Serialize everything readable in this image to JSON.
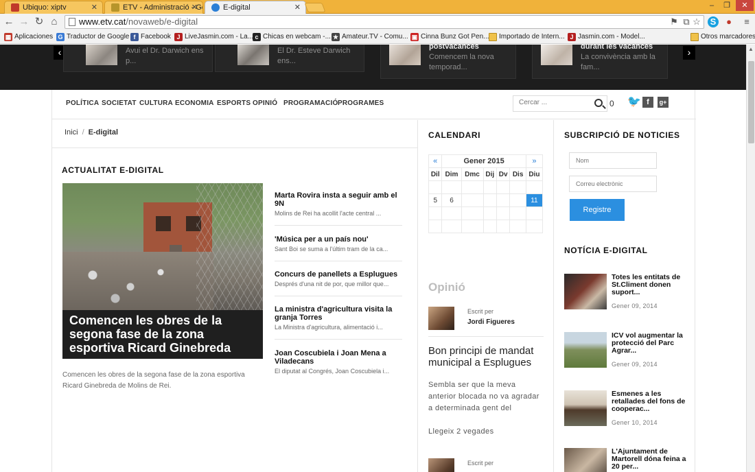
{
  "browser": {
    "tabs": [
      {
        "title": "Ubiquo: xiptv",
        "color": "#c0392b"
      },
      {
        "title": "ETV - Administració - Ges",
        "color": "#b7952b"
      },
      {
        "title": "E-digital",
        "color": "#2b7fd6"
      }
    ],
    "url_host": "www.etv.cat",
    "url_path": "/novaweb/e-digital",
    "bookmarks": [
      {
        "label": "Aplicaciones",
        "color": "#c0392b"
      },
      {
        "label": "Traductor de Google",
        "color": "#3a7bd5"
      },
      {
        "label": "Facebook",
        "color": "#3b5998"
      },
      {
        "label": "LiveJasmin.com - La...",
        "color": "#b41f1f"
      },
      {
        "label": "Chicas en webcam -...",
        "color": "#222222"
      },
      {
        "label": "Amateur.TV - Comu...",
        "color": "#444444"
      },
      {
        "label": "Cinna Bunz Got Pen...",
        "color": "#cc2222"
      },
      {
        "label": "Importado de Intern...",
        "color": "folder"
      },
      {
        "label": "Jasmin.com - Model...",
        "color": "#b41f1f"
      },
      {
        "label": "Otros marcadores",
        "color": "folder"
      }
    ]
  },
  "slider": {
    "cards": [
      {
        "title": "",
        "text": "Avui el Dr. Darwich ens p..."
      },
      {
        "title": "",
        "text": "El Dr. Esteve Darwich ens..."
      },
      {
        "title": "postvacances",
        "text": "Comencem la nova temporad..."
      },
      {
        "title": "durant les vacances",
        "text": "La convivència amb la fam..."
      }
    ],
    "prev": "‹",
    "next": "›"
  },
  "nav": {
    "items": [
      "POLÍTICA",
      "SOCIETAT",
      "CULTURA",
      "ECONOMIA",
      "ESPORTS",
      "OPINIÓ",
      "PROGRAMACIÓ",
      "PROGRAMES"
    ],
    "search_placeholder": "Cercar ...",
    "count": "0",
    "social": [
      "twitter",
      "f",
      "g+"
    ]
  },
  "breadcrumb": {
    "home": "Inici",
    "sep": "/",
    "current": "E-digital"
  },
  "main": {
    "section_title": "ACTUALITAT E-DIGITAL",
    "featured_title": "Comencen les obres de la segona fase de la zona esportiva Ricard Ginebreda",
    "featured_desc": "Comencen les obres de la segona fase de la zona esportiva Ricard Ginebreda de Molins de Rei.",
    "news": [
      {
        "title": "Marta Rovira insta a seguir amb el 9N",
        "excerpt": "Molins de Rei ha acollit l'acte central ..."
      },
      {
        "title": "'Música per a un país nou'",
        "excerpt": "Sant Boi se suma a l'últim tram de la ca..."
      },
      {
        "title": "Concurs de panellets a Esplugues",
        "excerpt": "Després d'una nit de por, que millor que..."
      },
      {
        "title": "La ministra d'agricultura visita la granja Torres",
        "excerpt": "La Ministra d'agricultura, alimentació i..."
      },
      {
        "title": "Joan Coscubiela i Joan Mena a Viladecans",
        "excerpt": "El diputat al Congrés, Joan Coscubiela i..."
      }
    ]
  },
  "calendar": {
    "title": "CALENDARI",
    "prev": "«",
    "next": "»",
    "month": "Gener 2015",
    "days": [
      "Dil",
      "Dim",
      "Dmc",
      "Dij",
      "Dv",
      "Dis",
      "Diu"
    ],
    "rows": [
      [
        "",
        "",
        "",
        "",
        "",
        "",
        ""
      ],
      [
        "5",
        "6",
        "",
        "",
        "",
        "",
        "11"
      ],
      [
        "",
        "",
        "",
        "",
        "",
        "",
        ""
      ],
      [
        "",
        "",
        "",
        "",
        "",
        "",
        ""
      ]
    ]
  },
  "opinio": {
    "title": "Opinió",
    "author_label": "Escrit per",
    "author_name": "Jordi Figueres",
    "headline": "Bon principi de mandat municipal a Esplugues",
    "text": "Sembla ser que la meva anterior blocada no va agradar a determinada gent del",
    "readmore": "Llegeix 2 vegades",
    "author2_label": "Escrit per"
  },
  "subscribe": {
    "title": "SUBCRIPCIÓ DE NOTICIES",
    "name_placeholder": "Nom",
    "email_placeholder": "Correu electrònic",
    "button": "Registre"
  },
  "side_news": {
    "title": "NOTÍCIA E-DIGITAL",
    "items": [
      {
        "title": "Totes les entitats de St.Climent donen suport...",
        "date": "Gener 09, 2014"
      },
      {
        "title": "ICV vol augmentar la protecció del Parc Agrar...",
        "date": "Gener 09, 2014"
      },
      {
        "title": "Esmenes a les retallades del fons de cooperac...",
        "date": "Gener 10, 2014"
      },
      {
        "title": "L'Ajuntament de Martorell dóna feina a 20 per...",
        "date": ""
      }
    ]
  }
}
